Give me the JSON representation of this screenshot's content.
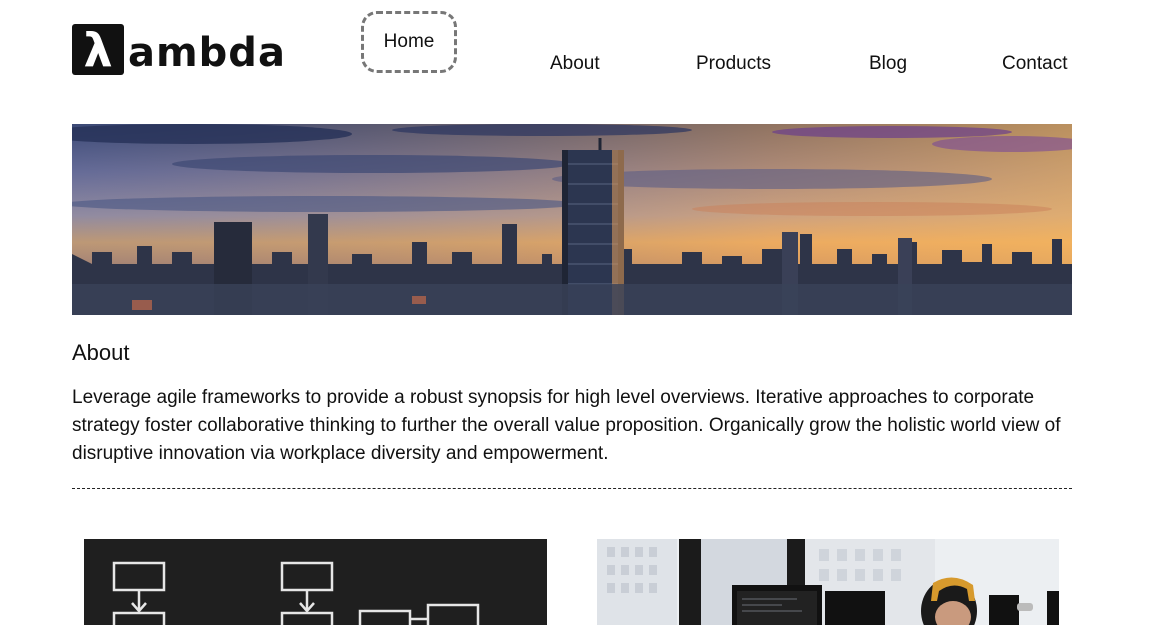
{
  "brand": {
    "mark": "λ",
    "name": "ambda"
  },
  "nav": {
    "items": [
      {
        "label": "Home",
        "active": true
      },
      {
        "label": "About"
      },
      {
        "label": "Products"
      },
      {
        "label": "Blog"
      },
      {
        "label": "Contact"
      }
    ]
  },
  "hero": {
    "image": "city-skyline-sunset"
  },
  "about": {
    "title": "About",
    "text": "Leverage agile frameworks to provide a robust synopsis for high level overviews. Iterative approaches to corporate strategy foster collaborative thinking to further the overall value proposition. Organically grow the holistic world view of disruptive innovation via workplace diversity and empowerment."
  },
  "cards": [
    {
      "image": "flowchart-chalkboard"
    },
    {
      "image": "person-at-computer-headphones"
    }
  ],
  "colors": {
    "text": "#111111",
    "dashed_border": "#777777"
  }
}
